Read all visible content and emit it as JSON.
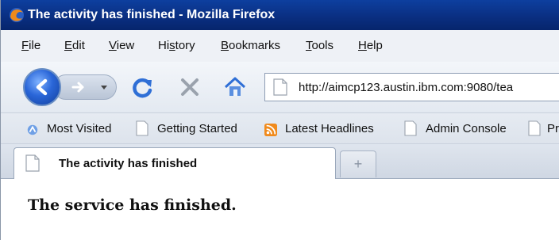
{
  "window": {
    "title": "The activity has finished - Mozilla Firefox"
  },
  "menubar": {
    "items": [
      {
        "label": "File",
        "underline": "F",
        "rest": "ile"
      },
      {
        "label": "Edit",
        "underline": "E",
        "rest": "dit"
      },
      {
        "label": "View",
        "underline": "V",
        "rest": "iew"
      },
      {
        "label": "History",
        "prefix": "Hi",
        "underline": "s",
        "rest": "tory"
      },
      {
        "label": "Bookmarks",
        "underline": "B",
        "rest": "ookmarks"
      },
      {
        "label": "Tools",
        "underline": "T",
        "rest": "ools"
      },
      {
        "label": "Help",
        "underline": "H",
        "rest": "elp"
      }
    ]
  },
  "navigation": {
    "url": "http://aimcp123.austin.ibm.com:9080/tea",
    "icons": [
      "back-icon",
      "forward-icon",
      "history-dropdown-icon",
      "reload-icon",
      "stop-icon",
      "home-icon",
      "page-icon"
    ]
  },
  "bookmarks": {
    "items": [
      {
        "label": "Most Visited",
        "icon": "most-visited-icon"
      },
      {
        "label": "Getting Started",
        "icon": "page-icon"
      },
      {
        "label": "Latest Headlines",
        "icon": "rss-icon"
      },
      {
        "label": "Admin Console",
        "icon": "page-icon"
      },
      {
        "label": "Pr",
        "icon": "page-icon"
      }
    ]
  },
  "tabs": {
    "active": {
      "label": "The activity has finished"
    },
    "new_tab_symbol": "+"
  },
  "content": {
    "message": "The service has finished."
  },
  "colors": {
    "titlebar": "#0a2f82",
    "menubar": "#eef1f6",
    "toolbar": "#e3e9f1",
    "reload_blue": "#2f6fd6",
    "stop_gray": "#9aa2ad",
    "rss_orange": "#f08a1c"
  }
}
